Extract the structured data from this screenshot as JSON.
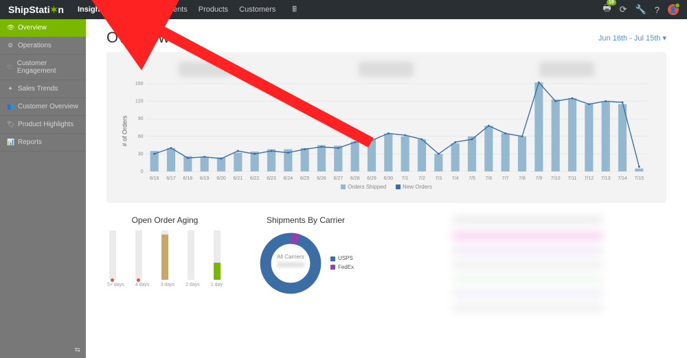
{
  "brand": {
    "text_pre": "ShipStati",
    "text_post": "n"
  },
  "nav": {
    "tabs": [
      "Insights",
      "Orders",
      "Shipments",
      "Products",
      "Customers"
    ],
    "print_count": "19"
  },
  "sidebar": {
    "items": [
      {
        "label": "Overview"
      },
      {
        "label": "Operations"
      },
      {
        "label": "Customer Engagement"
      },
      {
        "label": "Sales Trends"
      },
      {
        "label": "Customer Overview"
      },
      {
        "label": "Product Highlights"
      },
      {
        "label": "Reports"
      }
    ]
  },
  "page": {
    "title": "Overview",
    "date_range": "Jun 16th - Jul 15th ▾"
  },
  "chart_data": {
    "type": "bar+line",
    "ylabel": "# of Orders",
    "ylim": [
      0,
      150
    ],
    "yticks": [
      0,
      30,
      60,
      90,
      120,
      150
    ],
    "categories": [
      "6/16",
      "6/17",
      "6/18",
      "6/19",
      "6/20",
      "6/21",
      "6/22",
      "6/23",
      "6/24",
      "6/25",
      "6/26",
      "6/27",
      "6/28",
      "6/29",
      "6/30",
      "7/1",
      "7/2",
      "7/3",
      "7/4",
      "7/5",
      "7/6",
      "7/7",
      "7/8",
      "7/9",
      "7/10",
      "7/11",
      "7/12",
      "7/13",
      "7/14",
      "7/15"
    ],
    "series": [
      {
        "name": "Orders Shipped",
        "type": "bar",
        "values": [
          35,
          40,
          26,
          25,
          24,
          32,
          34,
          38,
          38,
          40,
          45,
          44,
          51,
          55,
          65,
          60,
          55,
          30,
          48,
          60,
          78,
          65,
          60,
          152,
          123,
          125,
          115,
          120,
          115,
          5
        ]
      },
      {
        "name": "New Orders",
        "type": "line",
        "values": [
          30,
          40,
          23,
          25,
          22,
          35,
          30,
          35,
          32,
          38,
          42,
          40,
          50,
          53,
          65,
          62,
          55,
          30,
          50,
          55,
          78,
          65,
          60,
          152,
          120,
          125,
          115,
          120,
          118,
          8
        ]
      }
    ],
    "legend": [
      "Orders Shipped",
      "New Orders"
    ]
  },
  "aging": {
    "title": "Open Order Aging",
    "labels": [
      "5+ days",
      "4 days",
      "3 days",
      "2 days",
      "1 day"
    ],
    "bars": [
      {
        "pct": 5,
        "style": "reddot"
      },
      {
        "pct": 3,
        "style": "reddot"
      },
      {
        "pct": 92,
        "style": "tan"
      },
      {
        "pct": 3,
        "style": "none"
      },
      {
        "pct": 35,
        "style": "green"
      }
    ]
  },
  "donut": {
    "title": "Shipments By Carrier",
    "center": "All Carriers",
    "legend": [
      {
        "name": "USPS",
        "color": "us"
      },
      {
        "name": "FedEx",
        "color": "fx"
      }
    ],
    "slices": [
      {
        "name": "USPS",
        "pct": 95
      },
      {
        "name": "FedEx",
        "pct": 5
      }
    ]
  }
}
